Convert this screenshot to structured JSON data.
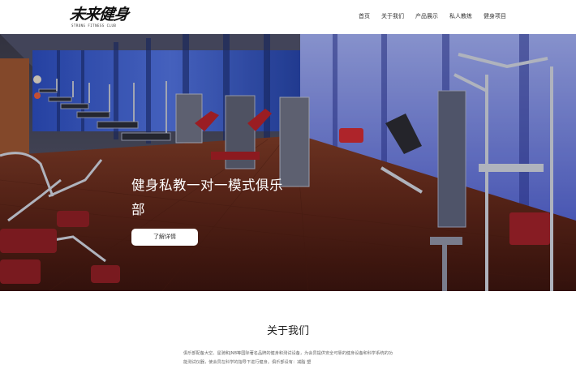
{
  "logo": {
    "main": "未来健身",
    "sub": "STRONG FITNESS CLUB"
  },
  "nav": {
    "items": [
      {
        "label": "首页"
      },
      {
        "label": "关于我们"
      },
      {
        "label": "产品展示"
      },
      {
        "label": "私人教练"
      },
      {
        "label": "健身项目"
      }
    ]
  },
  "hero": {
    "title": "健身私教一对一模式俱乐部",
    "button": "了解详情"
  },
  "about": {
    "title": "关于我们",
    "text": "俱乐部配备大空、星驰和JNB等国际著名品牌的健身和测试设备，为会员提供安全可靠的健身设备和科学系统的功能测试仪器，使会员在科学的指导下进行健身。俱乐部设有：减脂 塑"
  },
  "colors": {
    "floor": "#6b2a1e",
    "wall_blue": "#2f4fb0",
    "accent_red": "#b8262f"
  }
}
